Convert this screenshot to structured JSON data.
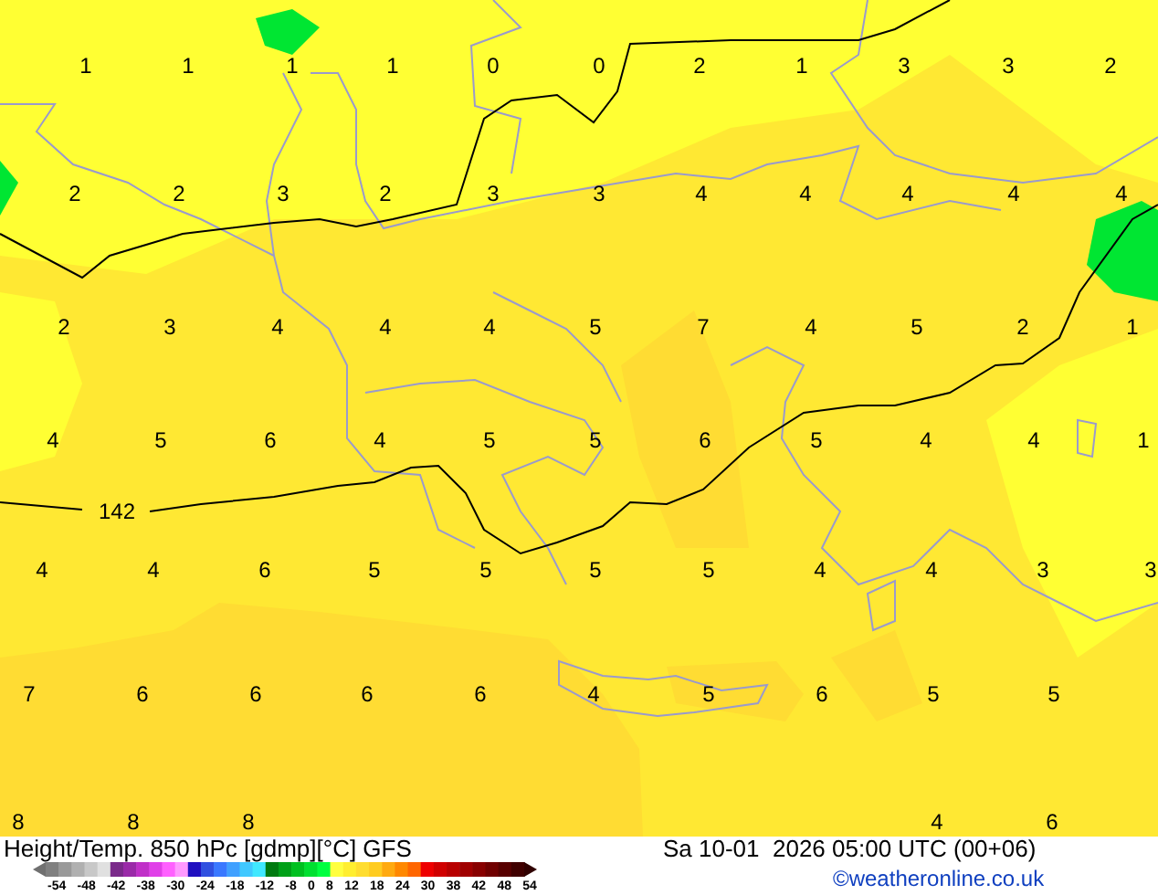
{
  "chart_title": "Height/Temp. 850 hPc [gdmp][°C] GFS",
  "valid_time": "Sa 10-01  2026 05:00 UTC (00+06)",
  "credit": "©weatheronline.co.uk",
  "contour_label": "142",
  "legend_ticks": [
    "-54",
    "-48",
    "-42",
    "-38",
    "-30",
    "-24",
    "-18",
    "-12",
    "-8",
    "0",
    "8",
    "12",
    "18",
    "24",
    "30",
    "38",
    "42",
    "48",
    "54"
  ],
  "map_labels": [
    [
      "1",
      "1",
      "1",
      "1",
      "0",
      "0",
      "2",
      "1",
      "3",
      "3",
      "2"
    ],
    [
      "2",
      "2",
      "3",
      "2",
      "3",
      "3",
      "4",
      "4",
      "4",
      "4",
      "4"
    ],
    [
      "2",
      "3",
      "4",
      "4",
      "4",
      "5",
      "7",
      "4",
      "5",
      "2",
      "1"
    ],
    [
      "4",
      "5",
      "6",
      "4",
      "5",
      "5",
      "6",
      "5",
      "4",
      "4",
      "1"
    ],
    [
      "4",
      "4",
      "6",
      "5",
      "5",
      "5",
      "5",
      "4",
      "4",
      "3",
      "3"
    ],
    [
      "7",
      "6",
      "6",
      "6",
      "6",
      "4",
      "5",
      "6",
      "5",
      "5"
    ],
    [
      "8",
      "8",
      "8",
      "4",
      "6"
    ]
  ]
}
